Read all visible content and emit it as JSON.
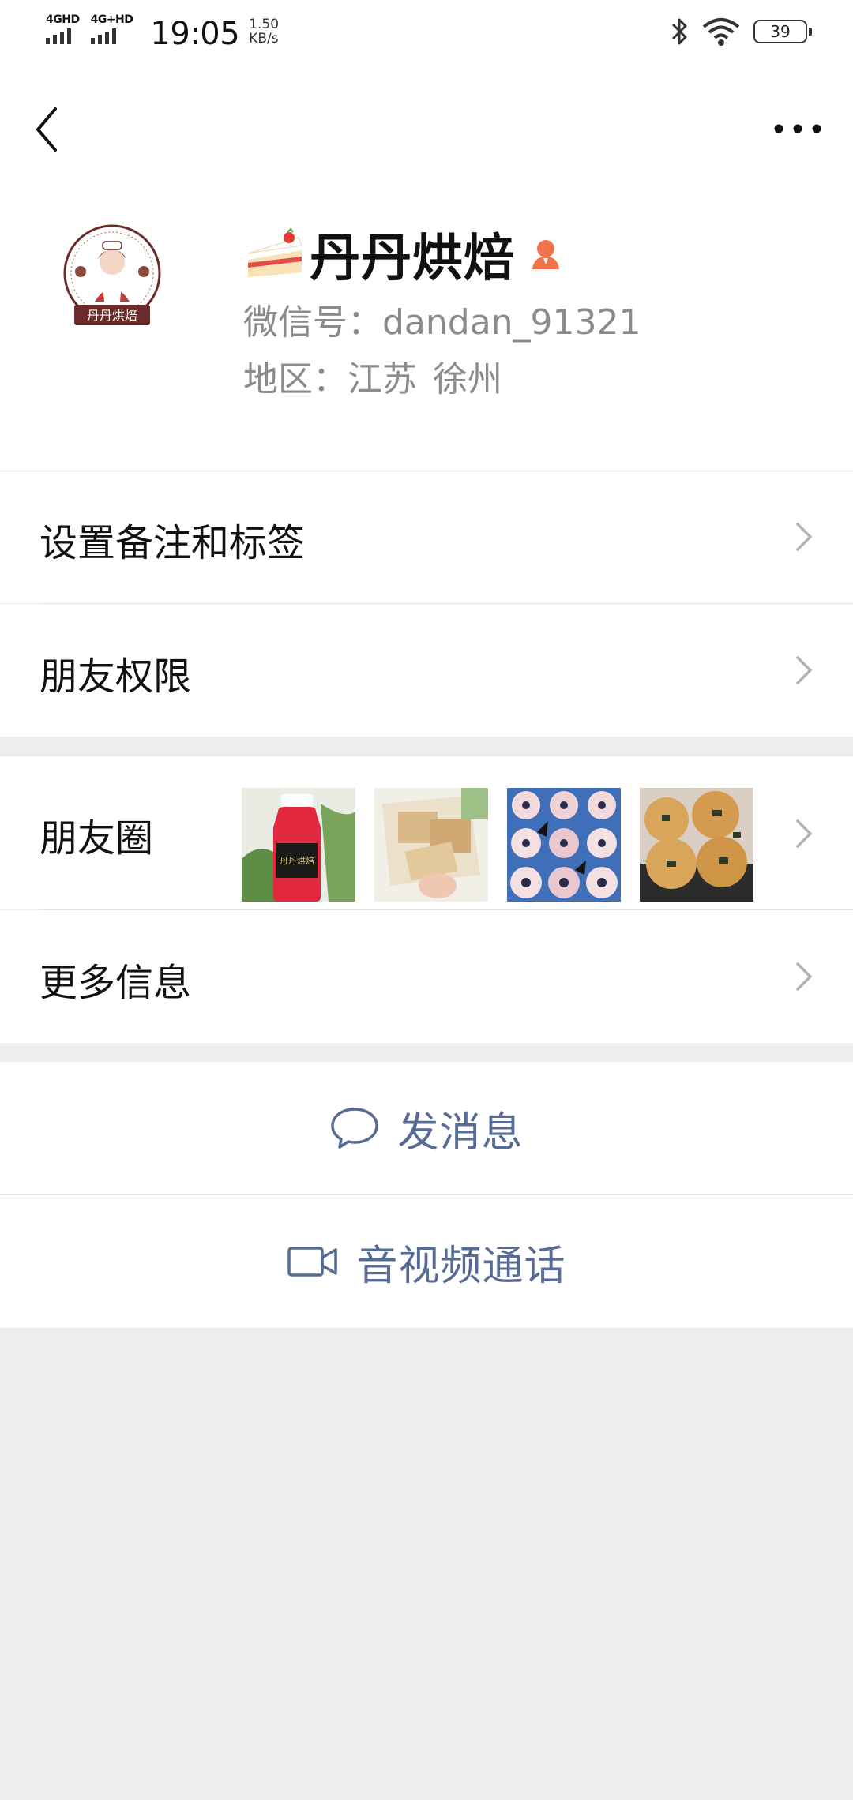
{
  "status_bar": {
    "sim1": "4GHD",
    "sim2": "4G+HD",
    "time": "19:05",
    "speed_value": "1.50",
    "speed_unit": "KB/s",
    "battery": "39"
  },
  "profile": {
    "name": "丹丹烘焙",
    "wechat_id": "微信号：dandan_91321",
    "region_label": "地区：",
    "region_province": "江苏",
    "region_city": "徐州",
    "avatar_text": "丹丹烘焙"
  },
  "menu": {
    "remarks_tags": "设置备注和标签",
    "friend_permissions": "朋友权限",
    "moments": "朋友圈",
    "more_info": "更多信息",
    "moments_thumb_label": "丹丹烘焙"
  },
  "actions": {
    "send_message": "发消息",
    "video_call": "音视频通话"
  },
  "colors": {
    "link_blue": "#576b95",
    "background": "#ededed",
    "gender_female": "#f0734d"
  }
}
